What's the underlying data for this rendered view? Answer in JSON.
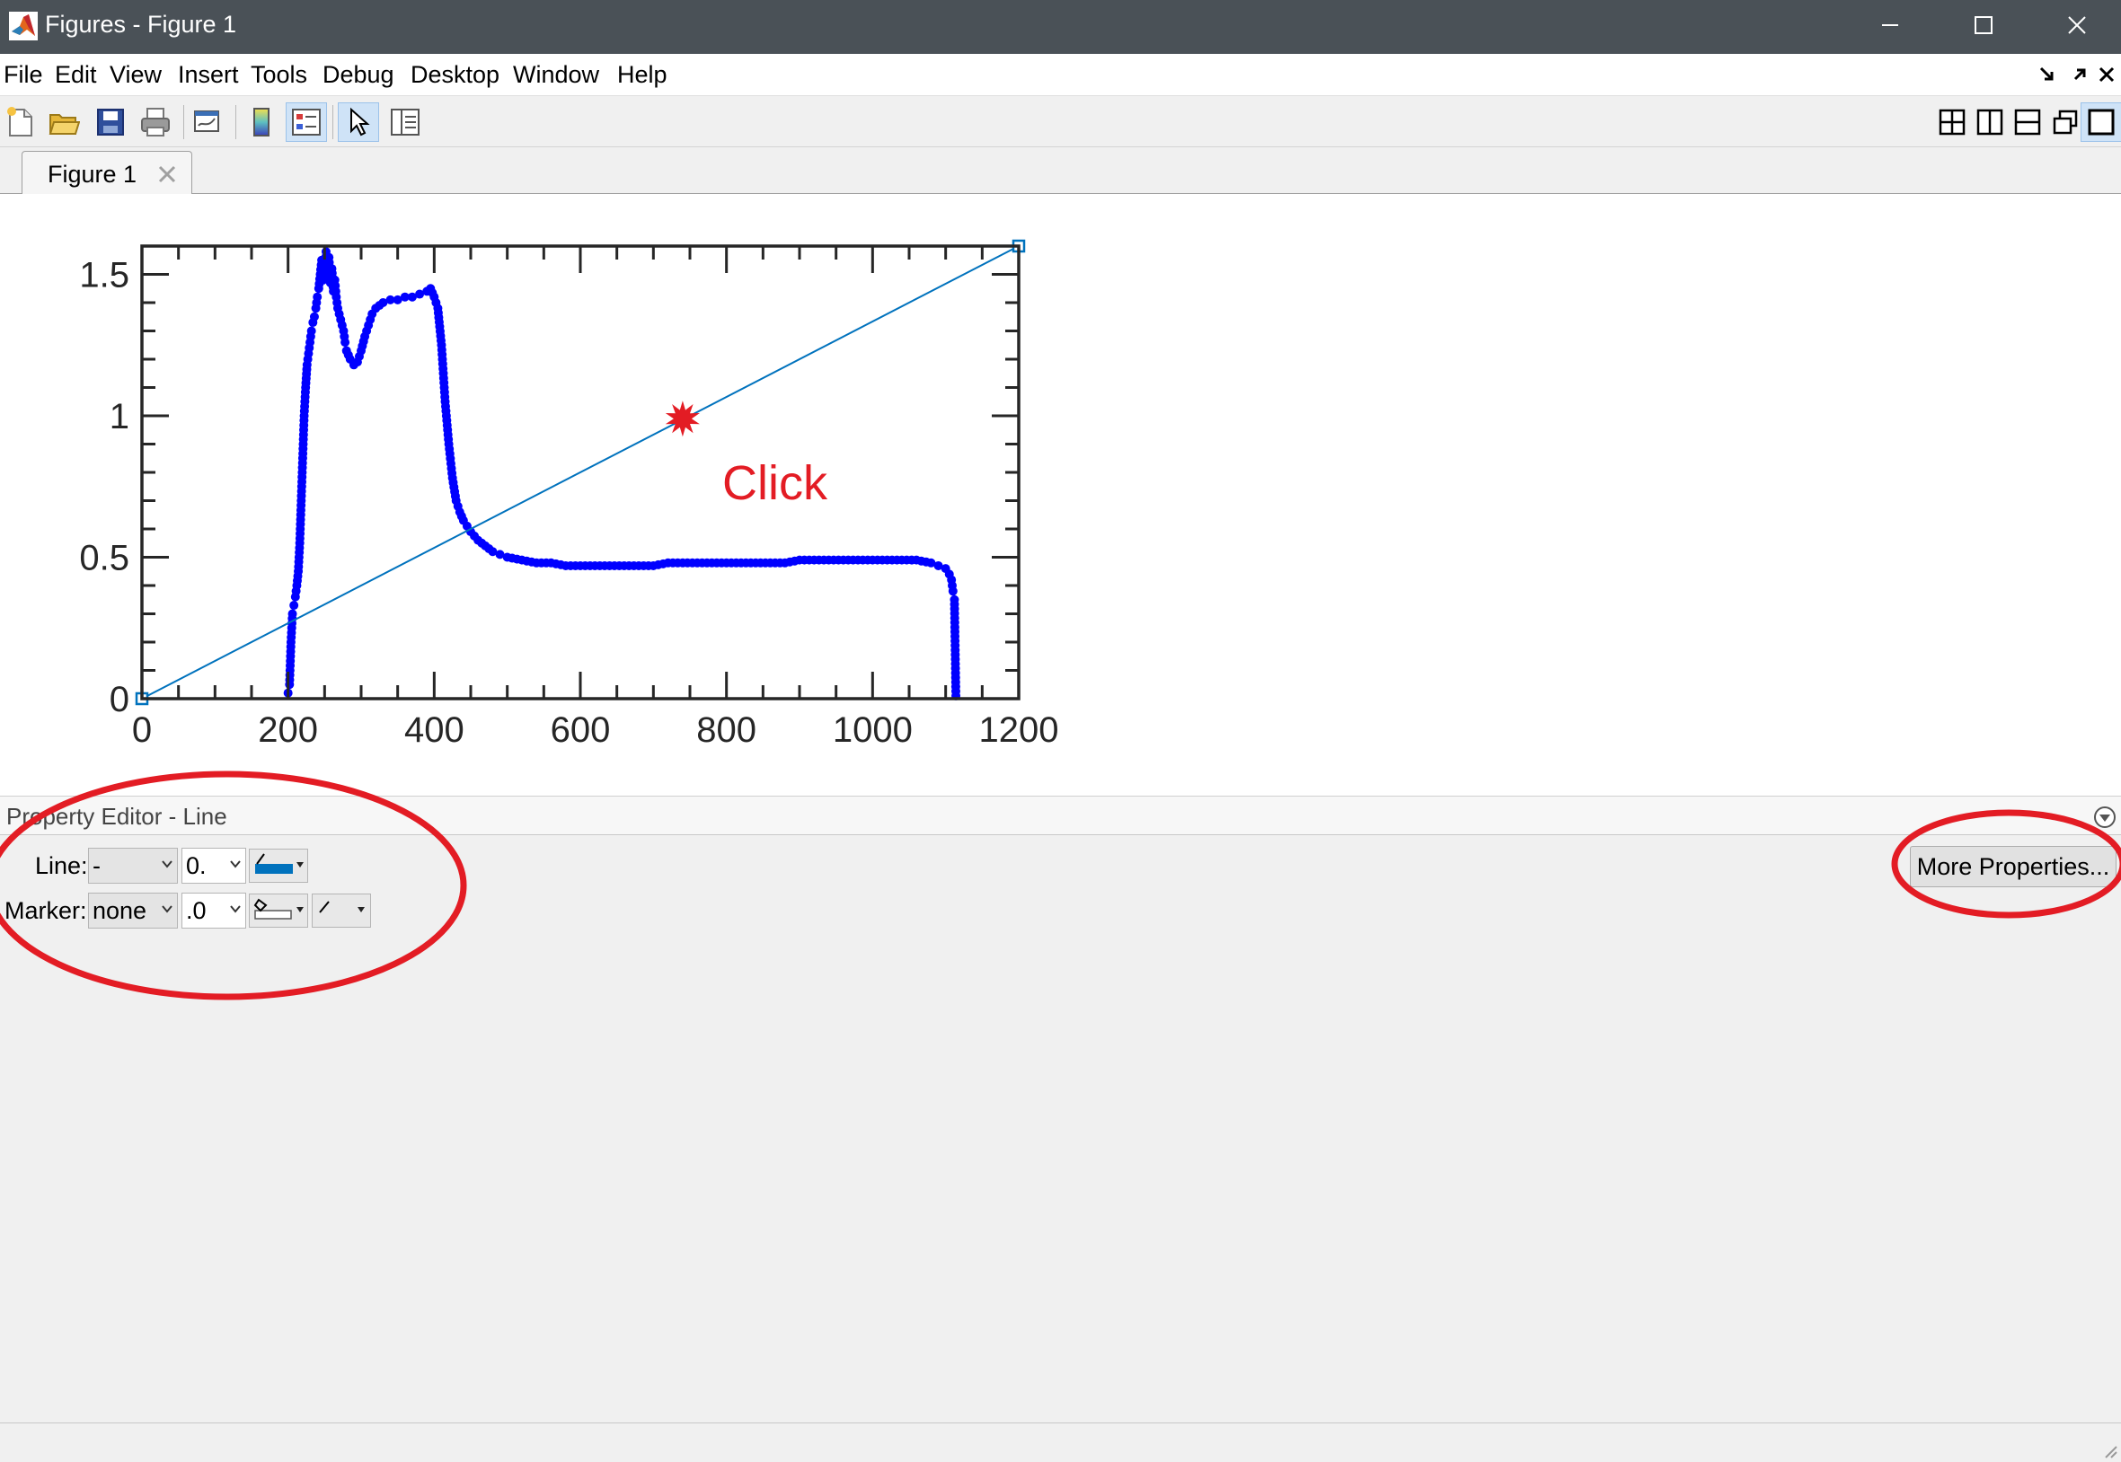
{
  "window": {
    "title": "Figures - Figure 1",
    "minimize_icon": "minimize-icon",
    "maximize_icon": "maximize-icon",
    "close_icon": "close-icon"
  },
  "menu": {
    "items": [
      "File",
      "Edit",
      "View",
      "Insert",
      "Tools",
      "Debug",
      "Desktop",
      "Window",
      "Help"
    ]
  },
  "toolbar": {
    "icons": [
      "new-figure-icon",
      "open-file-icon",
      "save-icon",
      "print-icon",
      "link-plot-icon",
      "colorbar-icon",
      "legend-icon",
      "edit-plot-icon",
      "property-editor-icon"
    ],
    "layout_icons": [
      "tile-grid-icon",
      "left-right-icon",
      "top-bottom-icon",
      "float-icon",
      "maximize-figure-icon"
    ]
  },
  "tabs": [
    {
      "label": "Figure 1"
    }
  ],
  "annotation": {
    "click_text": "Click",
    "accent_color": "#e31c24"
  },
  "chart_data": {
    "type": "scatter",
    "title": "",
    "xlabel": "",
    "ylabel": "",
    "xlim": [
      0,
      1200
    ],
    "ylim": [
      0,
      1.6
    ],
    "xticks": [
      0,
      200,
      400,
      600,
      800,
      1000,
      1200
    ],
    "xtick_labels": [
      "0",
      "200",
      "400",
      "600",
      "800",
      "1000",
      "1200"
    ],
    "yticks": [
      0,
      0.5,
      1,
      1.5
    ],
    "ytick_labels": [
      "0",
      "0.5",
      "1",
      "1.5"
    ],
    "grid": false,
    "series": [
      {
        "color": "#0000ff",
        "marker": "dot",
        "x": [
          200,
          202,
          204,
          206,
          208,
          210,
          212,
          214,
          216,
          218,
          220,
          222,
          224,
          226,
          228,
          230,
          232,
          234,
          236,
          238,
          240,
          242,
          244,
          246,
          248,
          250,
          252,
          254,
          256,
          258,
          260,
          262,
          264,
          266,
          268,
          270,
          272,
          274,
          276,
          278,
          280,
          285,
          290,
          295,
          300,
          305,
          310,
          315,
          320,
          330,
          340,
          350,
          360,
          370,
          380,
          390,
          395,
          400,
          405,
          410,
          415,
          420,
          425,
          430,
          435,
          440,
          445,
          450,
          460,
          470,
          480,
          490,
          500,
          520,
          540,
          560,
          580,
          600,
          620,
          640,
          660,
          680,
          700,
          720,
          740,
          760,
          780,
          800,
          820,
          840,
          860,
          880,
          900,
          920,
          940,
          960,
          980,
          1000,
          1020,
          1040,
          1060,
          1080,
          1090,
          1100,
          1105,
          1108,
          1110,
          1112,
          1114
        ],
        "y": [
          0.02,
          0.05,
          0.2,
          0.3,
          0.33,
          0.36,
          0.4,
          0.45,
          0.55,
          0.7,
          0.85,
          1.0,
          1.1,
          1.18,
          1.22,
          1.26,
          1.3,
          1.33,
          1.35,
          1.38,
          1.42,
          1.45,
          1.5,
          1.55,
          1.48,
          1.52,
          1.58,
          1.5,
          1.56,
          1.47,
          1.52,
          1.44,
          1.48,
          1.42,
          1.38,
          1.36,
          1.34,
          1.32,
          1.3,
          1.26,
          1.23,
          1.2,
          1.18,
          1.19,
          1.23,
          1.28,
          1.32,
          1.36,
          1.38,
          1.4,
          1.41,
          1.41,
          1.42,
          1.42,
          1.43,
          1.44,
          1.45,
          1.42,
          1.38,
          1.25,
          1.05,
          0.9,
          0.78,
          0.7,
          0.66,
          0.63,
          0.61,
          0.59,
          0.56,
          0.54,
          0.52,
          0.51,
          0.5,
          0.49,
          0.48,
          0.48,
          0.47,
          0.47,
          0.47,
          0.47,
          0.47,
          0.47,
          0.47,
          0.48,
          0.48,
          0.48,
          0.48,
          0.48,
          0.48,
          0.48,
          0.48,
          0.48,
          0.49,
          0.49,
          0.49,
          0.49,
          0.49,
          0.49,
          0.49,
          0.49,
          0.49,
          0.48,
          0.47,
          0.46,
          0.44,
          0.42,
          0.38,
          0.35,
          0.01
        ]
      },
      {
        "color": "#0072bd",
        "marker": "none",
        "selected": true,
        "x": [
          0,
          1200
        ],
        "y": [
          0,
          1.6
        ]
      }
    ],
    "click_marker": {
      "x": 740,
      "y": 0.99
    }
  },
  "property_editor": {
    "title": "Property Editor - Line",
    "line_label": "Line:",
    "line_style": "-",
    "line_width": "0.",
    "line_color": "#0072bd",
    "marker_label": "Marker:",
    "marker_style": "none",
    "marker_size": ".0",
    "more_properties_label": "More Properties...",
    "collapse_icon": "collapse-icon"
  }
}
